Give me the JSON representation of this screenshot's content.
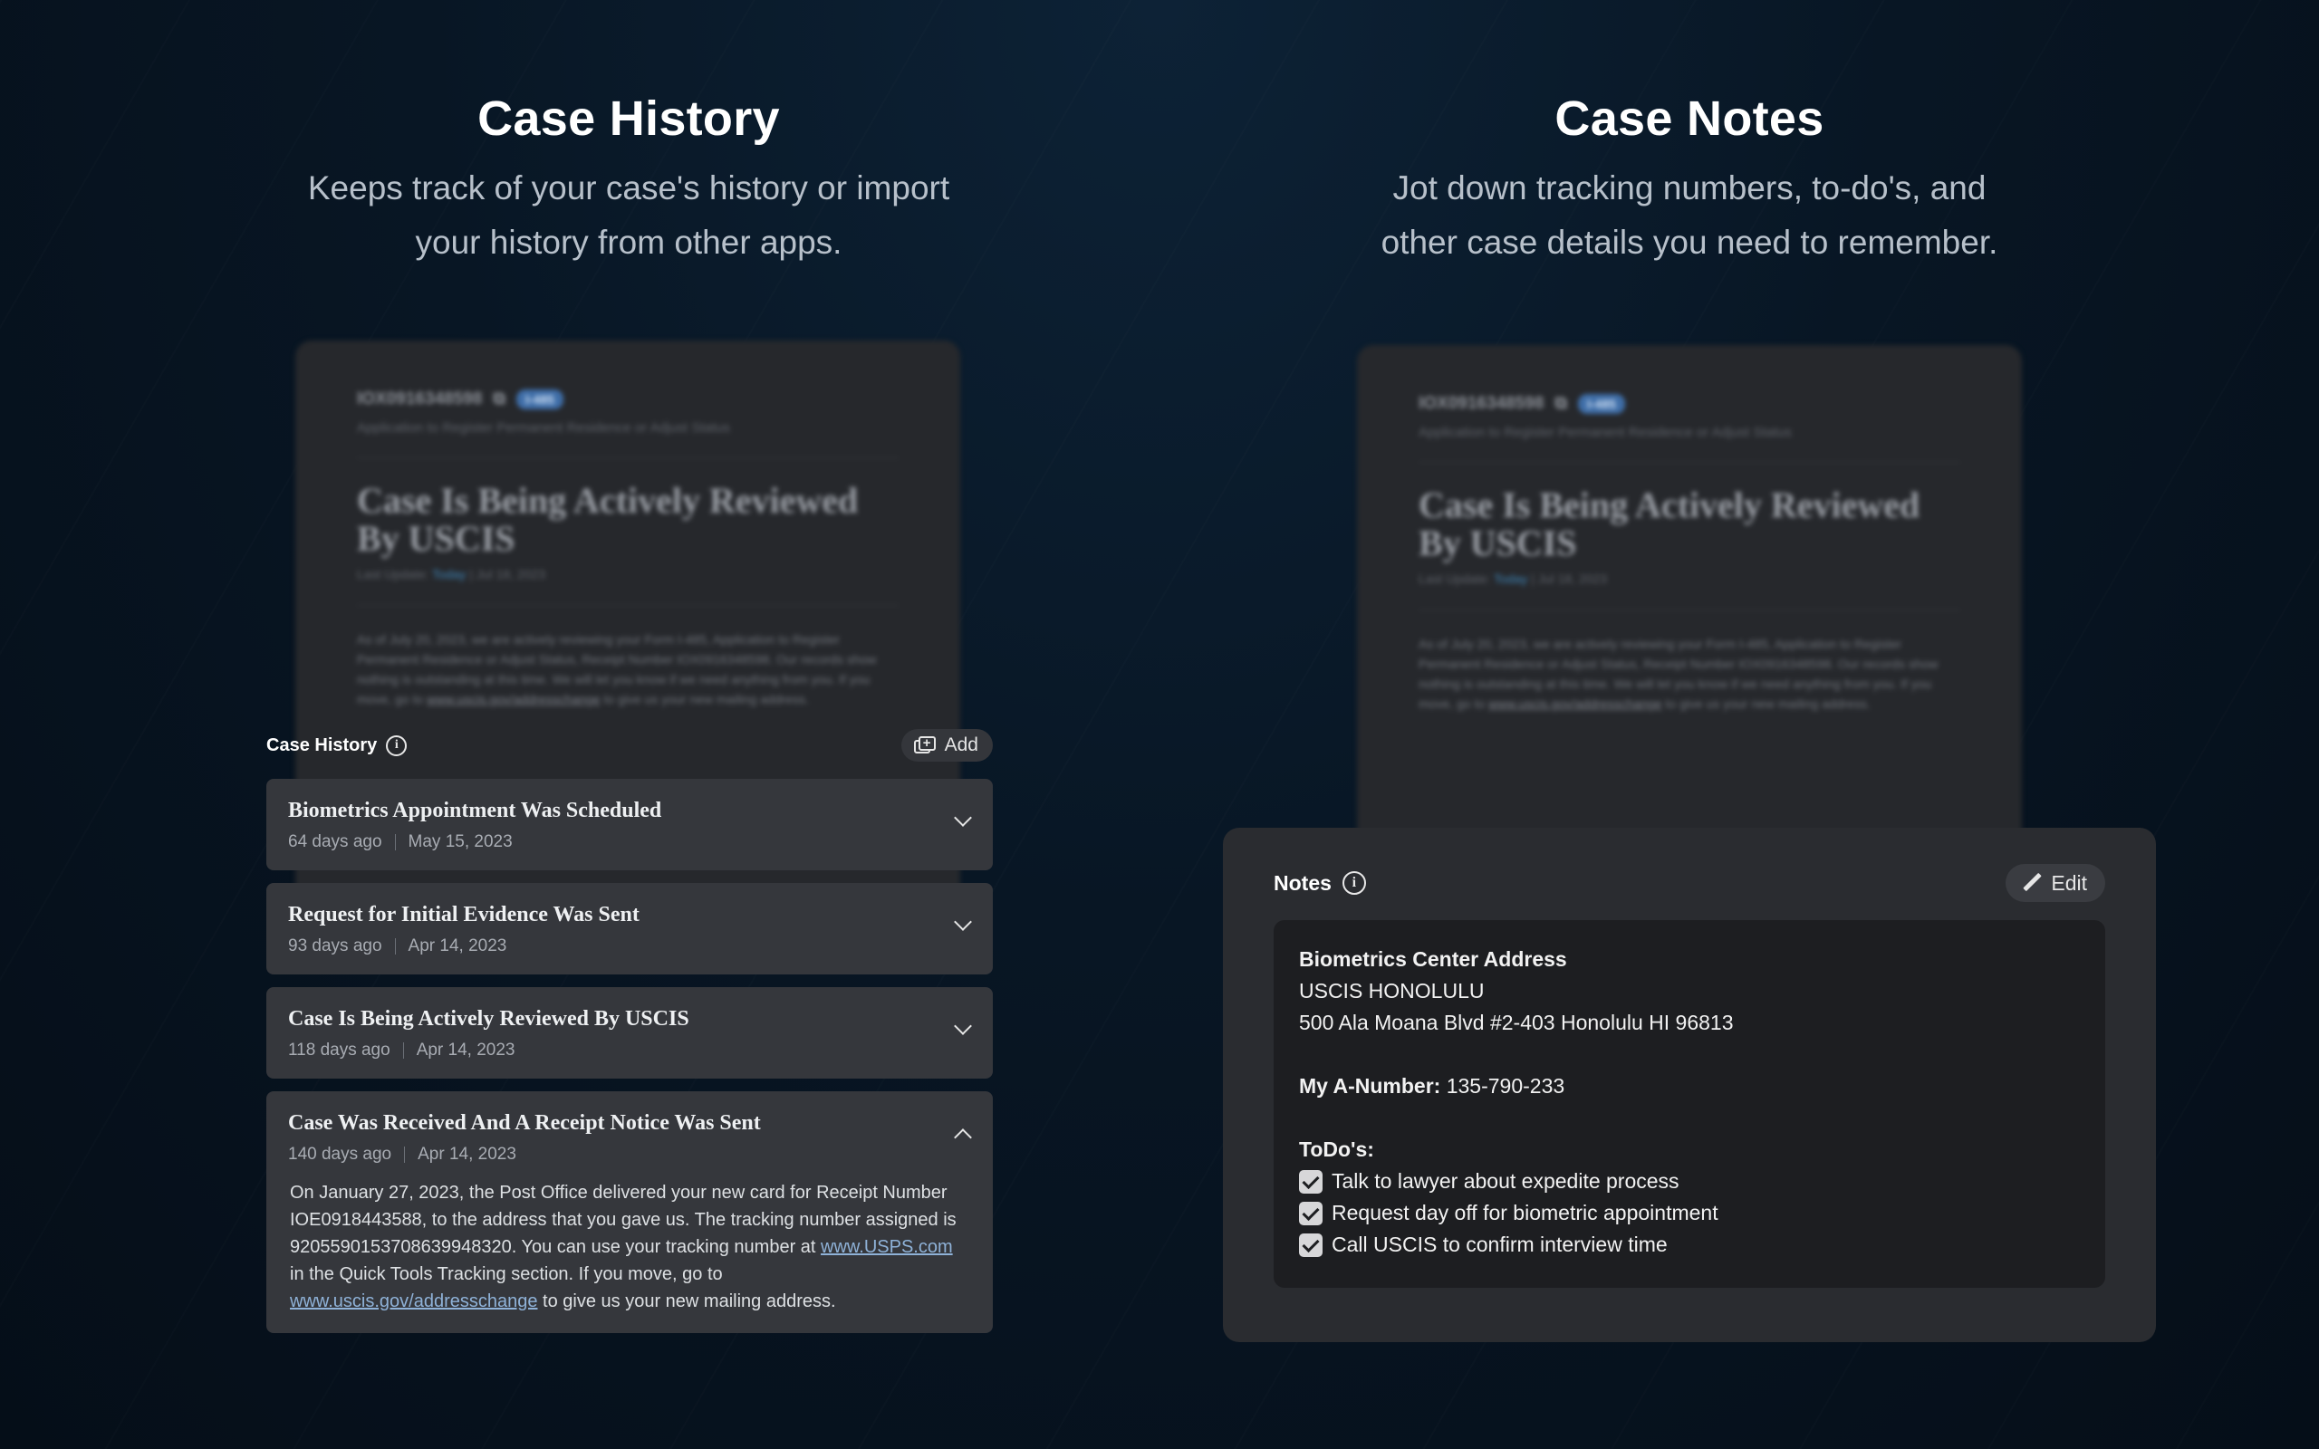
{
  "colors": {
    "background": "#081624",
    "card": "#35373c",
    "notes_box": "#1d1e21",
    "link": "#8fb2d8",
    "badge": "#3f6ea8"
  },
  "history_section": {
    "title": "Case History",
    "subtitle_line1": "Keeps track of your case's history or import",
    "subtitle_line2": "your history from other apps."
  },
  "notes_section": {
    "title": "Case Notes",
    "subtitle_line1": "Jot down tracking numbers, to-do's, and",
    "subtitle_line2": "other case details you need to remember."
  },
  "background_card": {
    "receipt": "IOX0916348598",
    "form_badge": "I-485",
    "form_name": "Application to Register Permanent Residence or Adjust Status",
    "status_title": "Case Is Being Actively Reviewed By USCIS",
    "last_update_label": "Last Update:",
    "last_update_today": "Today",
    "last_update_date": "| Jul 18, 2023",
    "body_text": "As of July 20, 2023, we are actively reviewing your Form I-485, Application to Register Permanent Residence or Adjust Status, Receipt Number IOX0916348598. Our records show nothing is outstanding at this time. We will let you know if we need anything from you. If you move, go to",
    "body_link": "www.uscis.gov/addresschange",
    "body_tail": "to give us your new mailing address."
  },
  "history_panel": {
    "title": "Case History",
    "info_icon": "info-icon",
    "add_label": "Add",
    "items": [
      {
        "title": "Biometrics Appointment Was Scheduled",
        "ago": "64 days ago",
        "date": "May 15, 2023",
        "expanded": false
      },
      {
        "title": "Request for Initial Evidence Was Sent",
        "ago": "93 days ago",
        "date": "Apr 14, 2023",
        "expanded": false
      },
      {
        "title": "Case Is Being Actively Reviewed By USCIS",
        "ago": "118 days ago",
        "date": "Apr 14, 2023",
        "expanded": false
      },
      {
        "title": "Case Was Received And A Receipt Notice Was Sent",
        "ago": "140 days ago",
        "date": "Apr 14, 2023",
        "expanded": true,
        "body_part1": "On January 27, 2023, the Post Office delivered your new card for Receipt Number IOE0918443588, to the address that you gave us. The tracking number assigned is 9205590153708639948320. You can use your tracking number at",
        "link1": "www.USPS.com",
        "body_part2": "in the Quick Tools Tracking section. If you move, go to",
        "link2": "www.uscis.gov/addresschange",
        "body_part3": "to give us your new mailing address."
      }
    ]
  },
  "notes_panel": {
    "title": "Notes",
    "edit_label": "Edit",
    "biometrics_heading": "Biometrics Center Address",
    "center_name": "USCIS HONOLULU",
    "center_address": "500 Ala Moana Blvd #2-403 Honolulu HI 96813",
    "a_number_label": "My A-Number:",
    "a_number_value": "135-790-233",
    "todos_heading": "ToDo's:",
    "todos": [
      {
        "text": "Talk to lawyer about expedite process",
        "checked": true
      },
      {
        "text": "Request day off for biometric appointment",
        "checked": true
      },
      {
        "text": "Call USCIS to confirm interview time",
        "checked": true
      }
    ]
  }
}
